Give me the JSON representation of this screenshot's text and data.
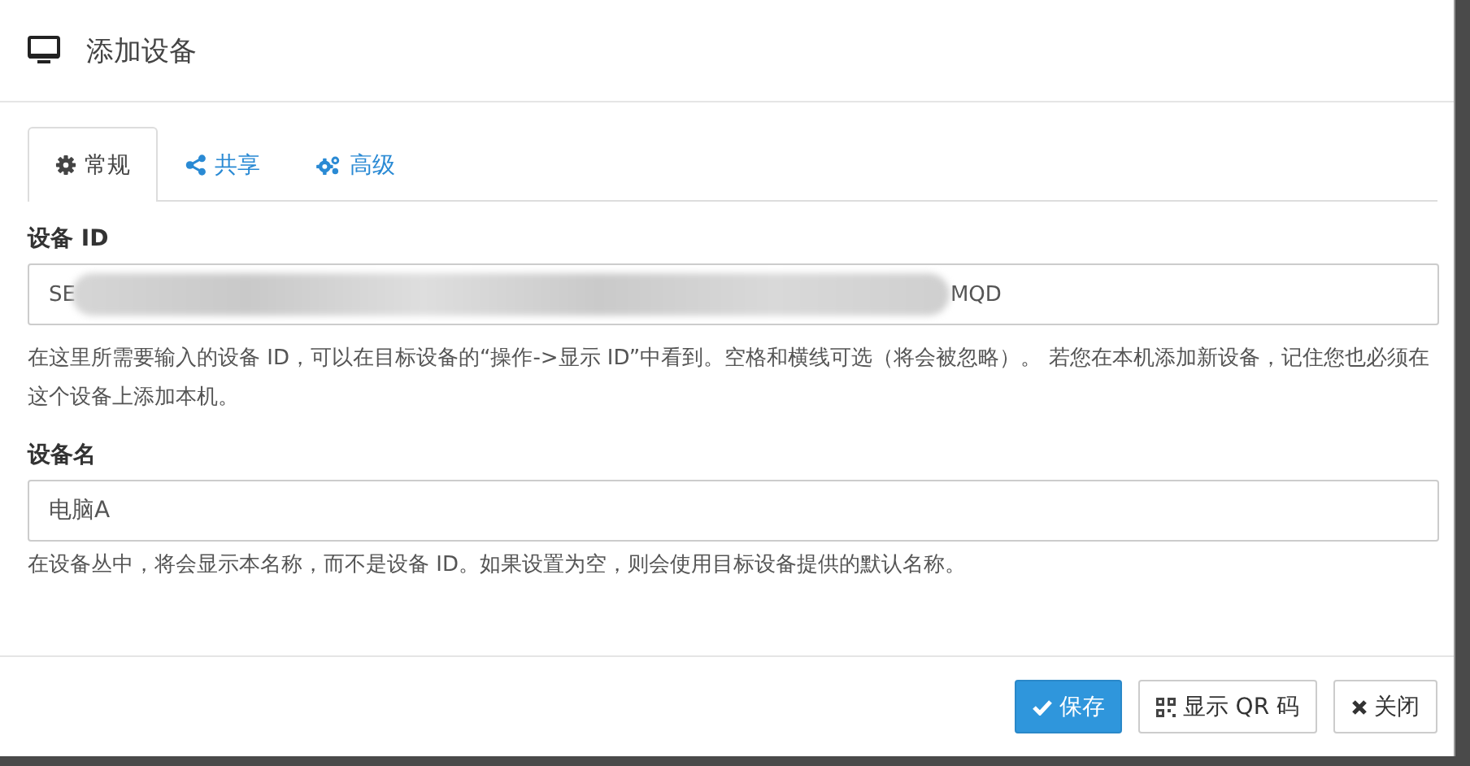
{
  "dialog": {
    "title": "添加设备"
  },
  "tabs": [
    {
      "label": "常规",
      "selected": true
    },
    {
      "label": "共享",
      "selected": false
    },
    {
      "label": "高级",
      "selected": false
    }
  ],
  "device_id": {
    "label": "设备 ID",
    "value_start": "SE",
    "value_end": "MQD",
    "help": "在这里所需要输入的设备 ID，可以在目标设备的“操作->显示 ID”中看到。空格和横线可选（将会被忽略）。 若您在本机添加新设备，记住您也必须在这个设备上添加本机。"
  },
  "device_name": {
    "label": "设备名",
    "value": "电脑A",
    "help": "在设备丛中，将会显示本名称，而不是设备 ID。如果设置为空，则会使用目标设备提供的默认名称。"
  },
  "buttons": [
    {
      "label": "保存",
      "kind": "primary"
    },
    {
      "label": "显示 QR 码",
      "kind": "default"
    },
    {
      "label": "关闭",
      "kind": "default"
    }
  ]
}
